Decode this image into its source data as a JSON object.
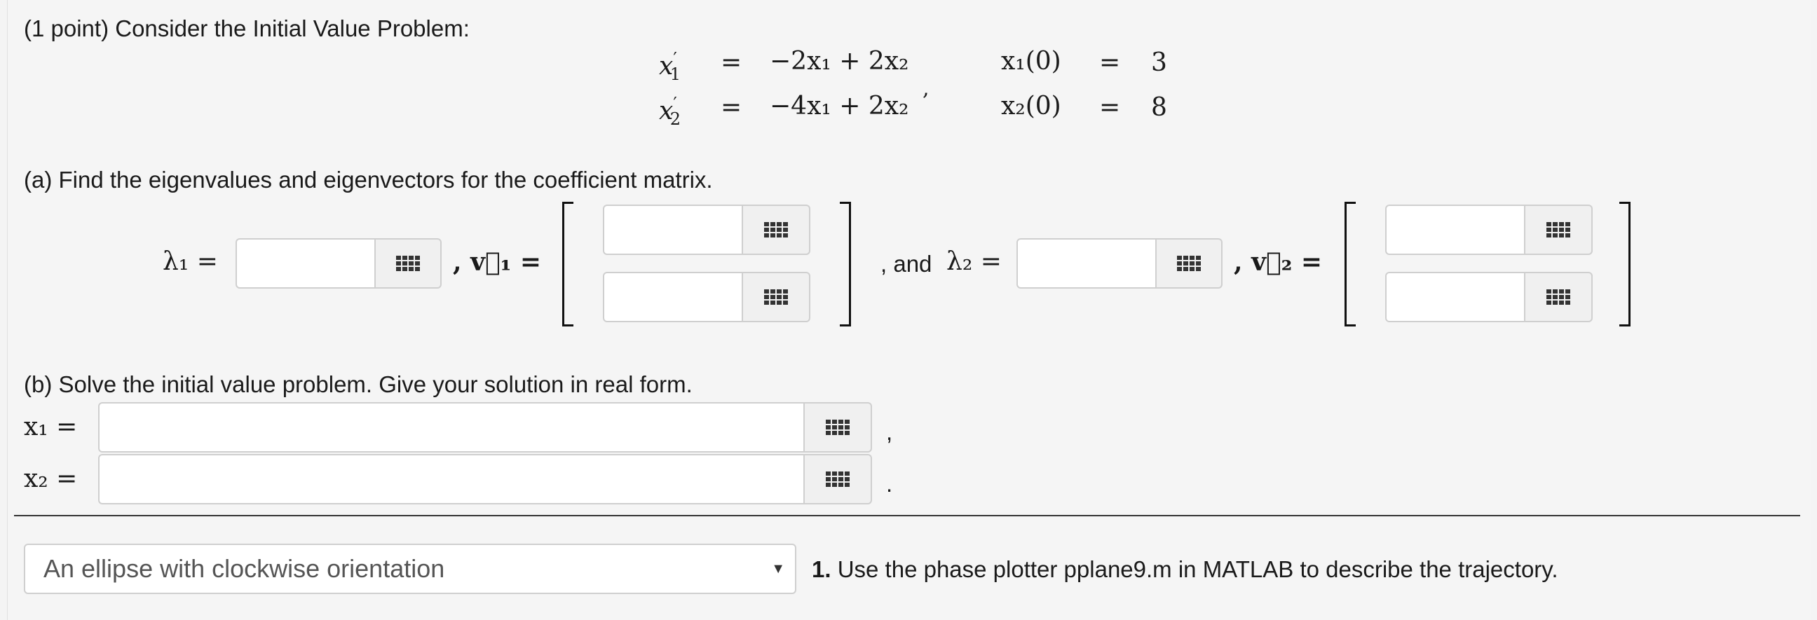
{
  "header": {
    "points": "(1 point)",
    "intro": " Consider the Initial Value Problem:"
  },
  "system": {
    "lhs1": "x",
    "lhs1_sub": "1",
    "lhs1_prime": "′",
    "lhs2": "x",
    "lhs2_sub": "2",
    "lhs2_prime": "′",
    "eq": "=",
    "rhs1": "−2x₁ + 2x₂",
    "rhs2": "−4x₁ + 2x₂",
    "comma": ",",
    "ic1_lhs": "x₁(0)",
    "ic2_lhs": "x₂(0)",
    "ic1_val": "3",
    "ic2_val": "8"
  },
  "part_a": {
    "prompt": "(a) Find the eigenvalues and eigenvectors for the coefficient matrix.",
    "lambda1_label": "λ₁ =",
    "v1_label": ", v⃗₁ =",
    "and_text": ", and",
    "lambda2_label": "λ₂ =",
    "v2_label": ", v⃗₂ ="
  },
  "part_b": {
    "prompt": "(b) Solve the initial value problem. Give your solution in real form.",
    "x1_label": "x₁ =",
    "x2_label": "x₂ =",
    "comma": ",",
    "period": "."
  },
  "question1": {
    "selected": "An ellipse with clockwise orientation",
    "number": "1.",
    "text": " Use the phase plotter pplane9.m in MATLAB to describe the trajectory."
  },
  "icons": {
    "palette": "equation-palette-icon",
    "dropdown": "chevron-down-icon"
  }
}
